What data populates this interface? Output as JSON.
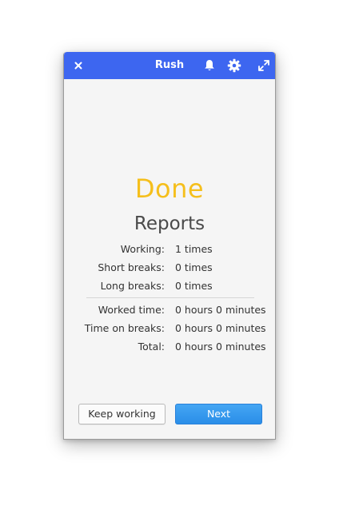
{
  "window": {
    "title": "Rush",
    "titlebar_color": "#3d66f0",
    "icons": {
      "close": "close-icon",
      "notifications": "bell-icon",
      "settings": "gear-icon",
      "maximize": "maximize-icon"
    }
  },
  "status": {
    "text": "Done",
    "color": "#f5bf1c"
  },
  "reports": {
    "heading": "Reports",
    "counts": [
      {
        "label": "Working:",
        "value": "1 times"
      },
      {
        "label": "Short breaks:",
        "value": "0 times"
      },
      {
        "label": "Long breaks:",
        "value": "0 times"
      }
    ],
    "durations": [
      {
        "label": "Worked time:",
        "value": "0 hours 0 minutes"
      },
      {
        "label": "Time on breaks:",
        "value": "0 hours 0 minutes"
      },
      {
        "label": "Total:",
        "value": "0 hours 0 minutes"
      }
    ]
  },
  "actions": {
    "keep_working_label": "Keep working",
    "next_label": "Next",
    "next_color": "#3396ee"
  }
}
